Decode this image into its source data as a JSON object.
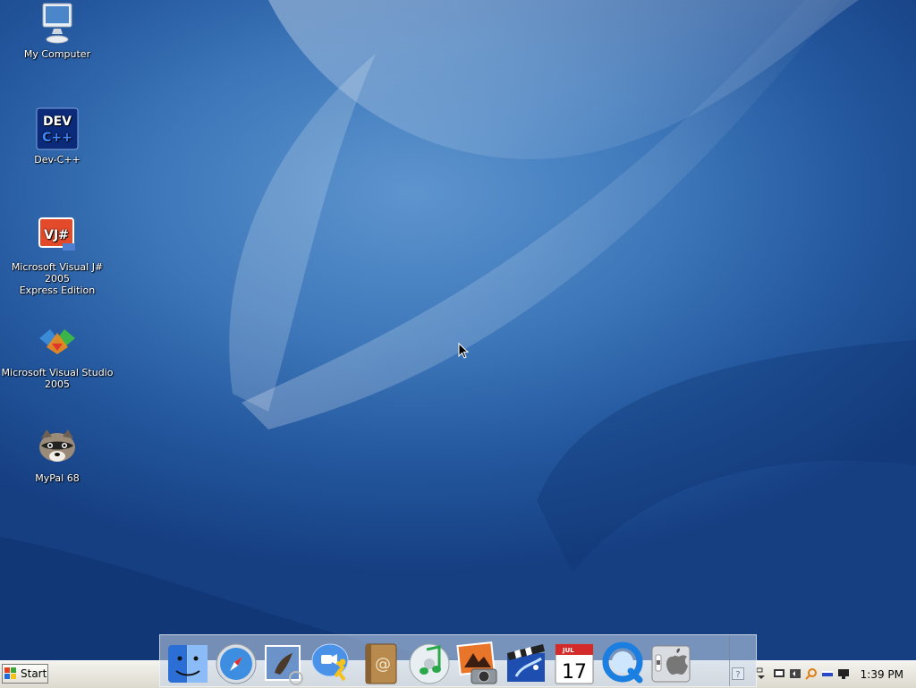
{
  "desktop": {
    "icons": [
      {
        "name": "my-computer",
        "label": "My Computer"
      },
      {
        "name": "dev-cpp",
        "label": "Dev-C++",
        "badge_top": "DEV",
        "badge_bottom": "C++"
      },
      {
        "name": "visual-jsharp",
        "label_line1": "Microsoft Visual J# 2005",
        "label_line2": "Express Edition",
        "badge": "VJ#"
      },
      {
        "name": "visual-studio",
        "label_line1": "Microsoft Visual Studio",
        "label_line2": "2005"
      },
      {
        "name": "mypal",
        "label": "MyPal 68"
      }
    ]
  },
  "taskbar": {
    "start_label": "Start",
    "clock": "1:39 PM"
  },
  "dock": {
    "items": [
      "finder-icon",
      "safari-icon",
      "mail-icon",
      "ichat-icon",
      "address-book-icon",
      "itunes-icon",
      "iphoto-icon",
      "imovie-icon",
      "ical-icon",
      "quicktime-icon",
      "system-preferences-icon"
    ],
    "ical_month": "JUL",
    "ical_day": "17"
  },
  "colors": {
    "wallpaper_top": "#5e95cf",
    "wallpaper_bottom": "#163f82",
    "taskbar": "#e8e6df"
  }
}
